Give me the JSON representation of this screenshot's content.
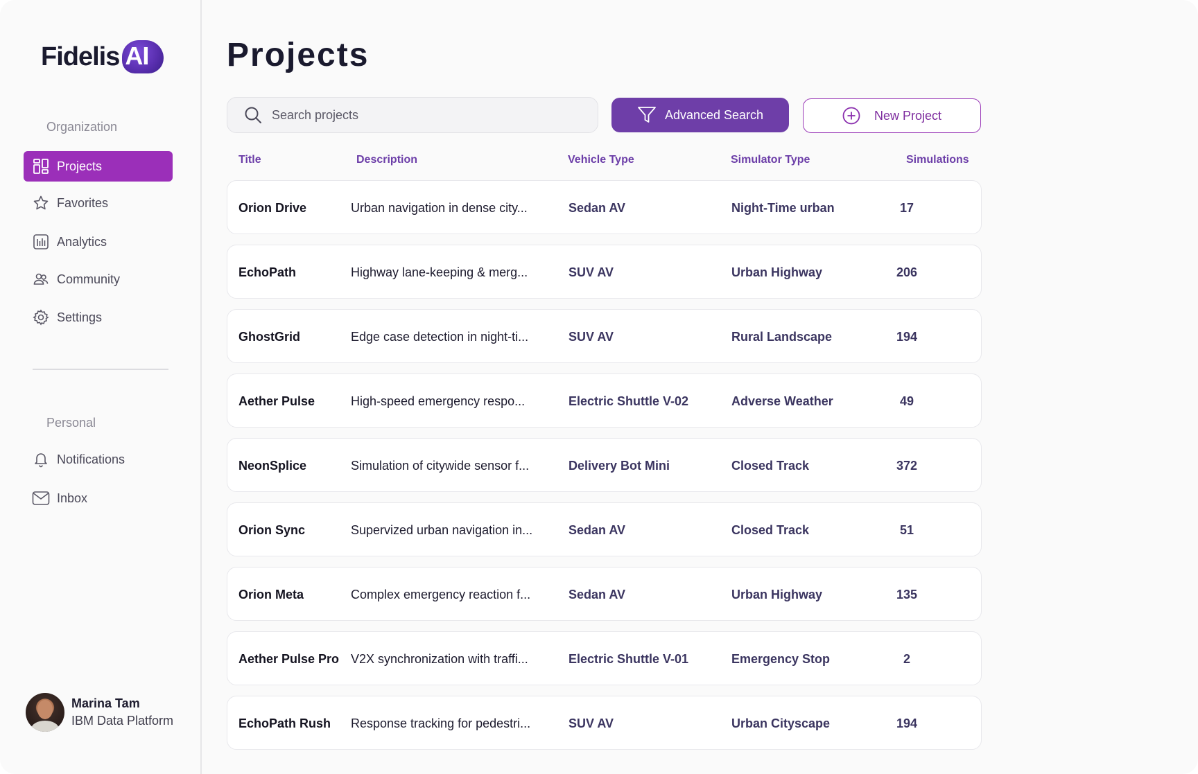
{
  "brand": {
    "name": "Fidelis",
    "suffix": "AI"
  },
  "sidebar": {
    "organization_label": "Organization",
    "org_items": [
      {
        "label": "Projects",
        "icon": "grid-icon",
        "active": true
      },
      {
        "label": "Favorites",
        "icon": "star-icon",
        "active": false
      },
      {
        "label": "Analytics",
        "icon": "bar-chart-icon",
        "active": false
      },
      {
        "label": "Community",
        "icon": "users-icon",
        "active": false
      },
      {
        "label": "Settings",
        "icon": "gear-icon",
        "active": false
      }
    ],
    "personal_label": "Personal",
    "personal_items": [
      {
        "label": "Notifications",
        "icon": "bell-icon"
      },
      {
        "label": "Inbox",
        "icon": "mail-icon"
      }
    ],
    "user": {
      "name": "Marina Tam",
      "org": "IBM Data Platform"
    }
  },
  "main": {
    "title": "Projects",
    "search": {
      "placeholder": "Search projects",
      "value": ""
    },
    "advanced_search_label": "Advanced Search",
    "new_project_label": "New Project",
    "columns": [
      "Title",
      "Description",
      "Vehicle Type",
      "Simulator Type",
      "Simulations"
    ],
    "rows": [
      {
        "title": "Orion Drive",
        "description": "Urban navigation in dense city...",
        "vehicle": "Sedan AV",
        "simulator": "Night-Time urban",
        "simulations": "17"
      },
      {
        "title": "EchoPath",
        "description": "Highway lane-keeping & merg...",
        "vehicle": "SUV AV",
        "simulator": "Urban Highway",
        "simulations": "206"
      },
      {
        "title": "GhostGrid",
        "description": "Edge case detection in night-ti...",
        "vehicle": "SUV AV",
        "simulator": "Rural Landscape",
        "simulations": "194"
      },
      {
        "title": "Aether Pulse",
        "description": "High-speed emergency respo...",
        "vehicle": "Electric Shuttle V-02",
        "simulator": "Adverse Weather",
        "simulations": "49"
      },
      {
        "title": "NeonSplice",
        "description": "Simulation of citywide sensor f...",
        "vehicle": "Delivery Bot Mini",
        "simulator": "Closed Track",
        "simulations": "372"
      },
      {
        "title": "Orion Sync",
        "description": "Supervized urban navigation in...",
        "vehicle": "Sedan AV",
        "simulator": "Closed Track",
        "simulations": "51"
      },
      {
        "title": "Orion Meta",
        "description": "Complex emergency reaction f...",
        "vehicle": "Sedan AV",
        "simulator": "Urban Highway",
        "simulations": "135"
      },
      {
        "title": "Aether Pulse Pro",
        "description": "V2X synchronization with traffi...",
        "vehicle": "Electric Shuttle V-01",
        "simulator": "Emergency Stop",
        "simulations": "2"
      },
      {
        "title": "EchoPath Rush",
        "description": "Response tracking for pedestri...",
        "vehicle": "SUV AV",
        "simulator": "Urban Cityscape",
        "simulations": "194"
      }
    ]
  },
  "colors": {
    "accent": "#9b2fb9",
    "button_primary": "#6e3ea8",
    "header_text": "#6c3ea8",
    "cell_text": "#3b3560"
  }
}
